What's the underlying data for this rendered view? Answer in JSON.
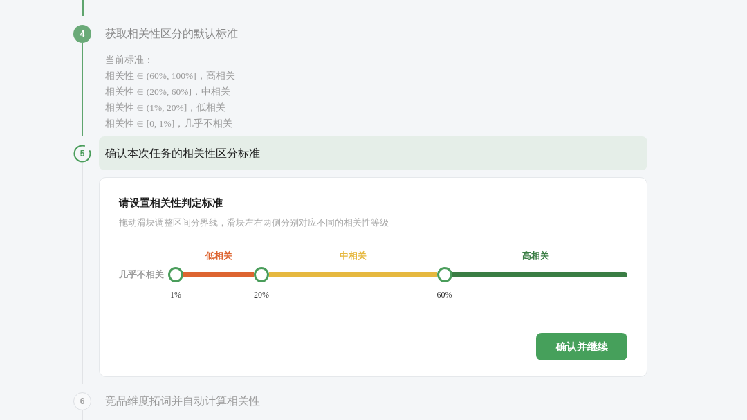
{
  "steps": [
    {
      "number": "4",
      "title": "获取相关性区分的默认标准",
      "completed": true,
      "current": false,
      "details": [
        "当前标准：",
        "相关性 ∈ (60%, 100%]，高相关",
        "相关性 ∈ (20%, 60%]，中相关",
        "相关性 ∈ (1%, 20%]，低相关",
        "相关性 ∈ [0, 1%]，几乎不相关"
      ]
    },
    {
      "number": "5",
      "title": "确认本次任务的相关性区分标准",
      "completed": false,
      "current": true,
      "panel": {
        "title": "请设置相关性判定标准",
        "subtitle": "拖动滑块调整区间分界线，滑块左右两侧分别对应不同的相关性等级",
        "slider": {
          "min_label": "几乎不相关",
          "handles": [
            {
              "value": "1%",
              "level": 0
            },
            {
              "value": "20%",
              "level": 0.19
            },
            {
              "value": "60%",
              "level": 0.595
            }
          ],
          "bands": [
            {
              "label": "低相关",
              "color": "#dd6430"
            },
            {
              "label": "中相关",
              "color": "#e6b83f"
            },
            {
              "label": "高相关",
              "color": "#3a7d44"
            }
          ]
        },
        "button": "确认并继续"
      }
    },
    {
      "number": "6",
      "title": "竞品维度拓词并自动计算相关性",
      "completed": false,
      "current": false
    }
  ]
}
